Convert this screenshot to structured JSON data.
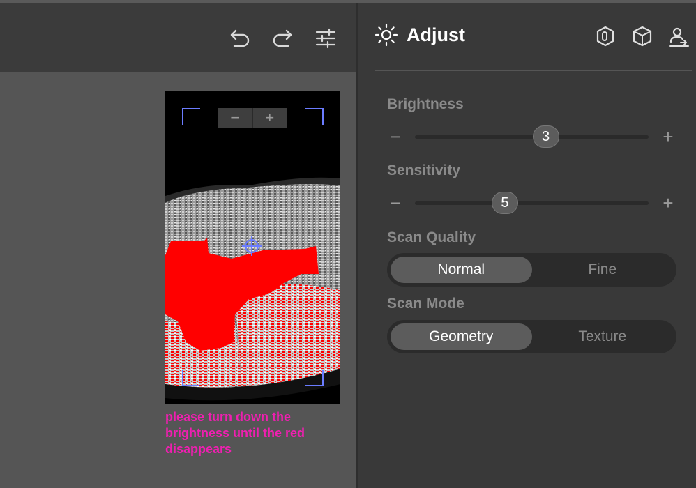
{
  "toolbar": {
    "undo_icon": "undo-icon",
    "redo_icon": "redo-icon",
    "settings_icon": "sliders-icon"
  },
  "preview": {
    "zoom_out_label": "−",
    "zoom_in_label": "+",
    "warning_text": "please turn down the brightness until the red disappears",
    "colors": {
      "overexposed": "#ff0000",
      "warning": "#f01fb1",
      "frame_corner": "#6b7cff"
    }
  },
  "panel": {
    "title": "Adjust",
    "title_icon": "sun-icon",
    "header_icons": [
      "hexagon-icon",
      "cube-icon",
      "user-switch-icon"
    ],
    "brightness": {
      "label": "Brightness",
      "value": "3",
      "level": 0.56
    },
    "sensitivity": {
      "label": "Sensitivity",
      "value": "5",
      "level": 0.385
    },
    "scan_quality": {
      "label": "Scan Quality",
      "options": [
        "Normal",
        "Fine"
      ],
      "selected": "Normal"
    },
    "scan_mode": {
      "label": "Scan Mode",
      "options": [
        "Geometry",
        "Texture"
      ],
      "selected": "Geometry"
    },
    "slider_minus": "−",
    "slider_plus": "+"
  }
}
